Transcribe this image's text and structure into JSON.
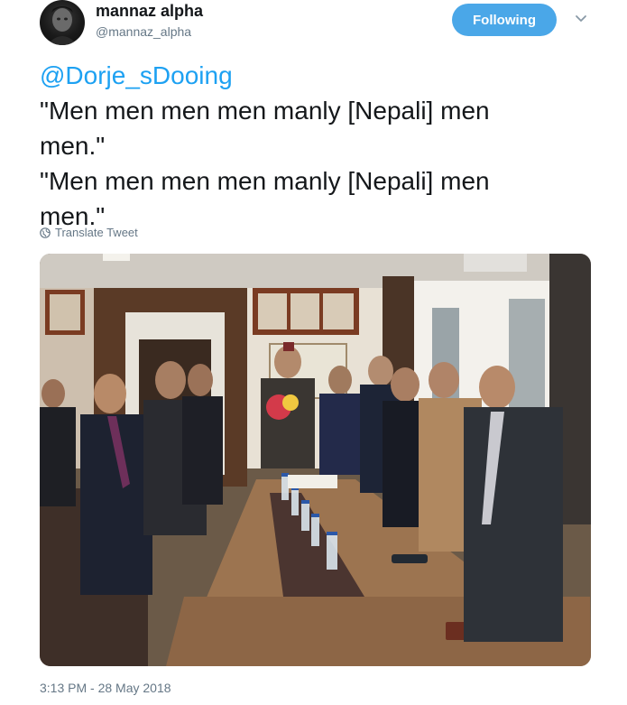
{
  "user": {
    "display_name": "mannaz alpha",
    "handle": "@mannaz_alpha"
  },
  "follow_button": {
    "label": "Following"
  },
  "tweet": {
    "mention": "@Dorje_sDooing",
    "lines": [
      "\"Men men men men manly [Nepali] men",
      "men.\"",
      "\"Men men men men manly [Nepali] men",
      "men.\""
    ]
  },
  "translate": {
    "label": "Translate Tweet"
  },
  "timestamp": "3:13 PM - 28 May 2018",
  "icons": {
    "chevron": "chevron-down-icon",
    "globe": "globe-icon"
  },
  "colors": {
    "follow_button": "#4aa7e8",
    "mention": "#1da1f2",
    "secondary_text": "#657786"
  }
}
